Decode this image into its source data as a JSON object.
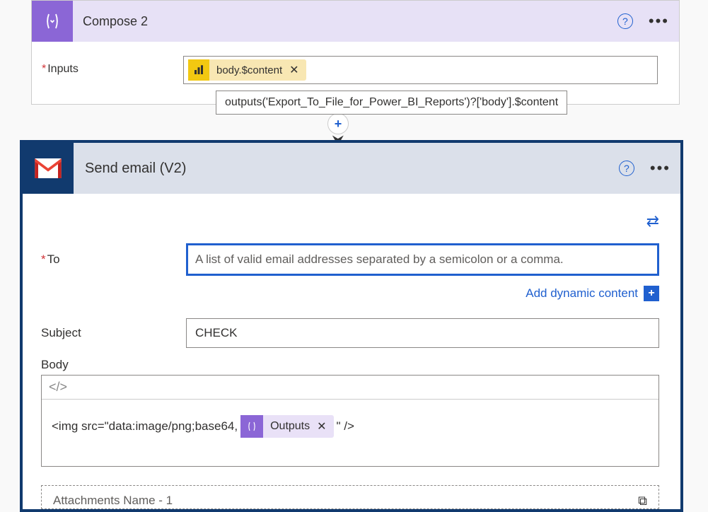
{
  "compose": {
    "title": "Compose 2",
    "inputs_label": "Inputs",
    "token_label": "body.$content",
    "tooltip": "outputs('Export_To_File_for_Power_BI_Reports')?['body'].$content"
  },
  "email": {
    "title": "Send email (V2)",
    "to_label": "To",
    "to_placeholder": "A list of valid email addresses separated by a semicolon or a comma.",
    "dynamic_link": "Add dynamic content",
    "subject_label": "Subject",
    "subject_value": "CHECK",
    "body_label": "Body",
    "body_prefix": "<img src=\"data:image/png;base64,",
    "outputs_token": "Outputs",
    "body_suffix": "\" />",
    "attachments_label": "Attachments Name - 1"
  }
}
